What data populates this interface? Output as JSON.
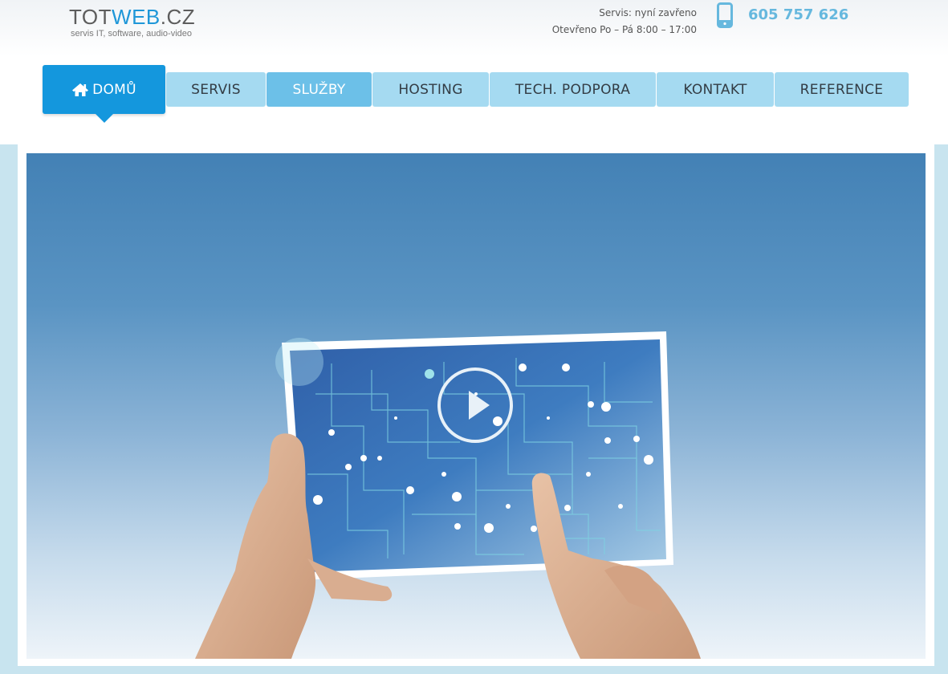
{
  "logo": {
    "title_main": "TOT",
    "title_accent": "WEB",
    "title_tail": ".CZ",
    "subtitle": "servis IT, software, audio-video"
  },
  "contact": {
    "status": "Servis: nyní zavřeno",
    "hours": "Otevřeno Po – Pá 8:00 – 17:00",
    "phone_icon": "phone-icon",
    "phone": "605 757 626"
  },
  "nav": {
    "items": [
      {
        "label": "DOMŮ",
        "icon": "home-icon"
      },
      {
        "label": "SERVIS"
      },
      {
        "label": "SLUŽBY"
      },
      {
        "label": "HOSTING"
      },
      {
        "label": "TECH. PODPORA"
      },
      {
        "label": "KONTAKT"
      },
      {
        "label": "REFERENCE"
      }
    ]
  },
  "hero": {
    "play_icon": "play-icon"
  },
  "colors": {
    "accent": "#1497dd",
    "nav_bg": "#a5daf1",
    "nav_hover": "#6cc0e8",
    "phone": "#66b8de",
    "frame": "#c8e4ef"
  }
}
